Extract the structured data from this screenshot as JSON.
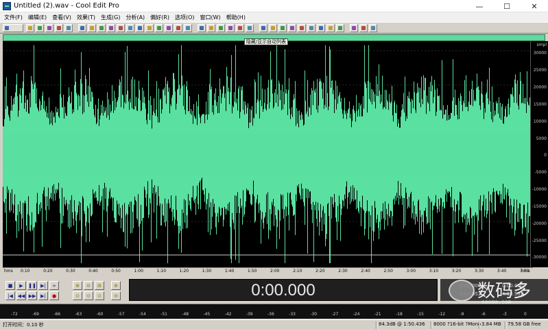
{
  "window": {
    "title": "Untitled (2).wav - Cool Edit Pro",
    "minimize": "—",
    "maximize": "☐",
    "close": "✕"
  },
  "menu": [
    "文件(F)",
    "编辑(E)",
    "查看(V)",
    "效果(T)",
    "生成(G)",
    "分析(A)",
    "偏好(R)",
    "选项(O)",
    "窗口(W)",
    "帮助(H)"
  ],
  "overview": {
    "toggle_label": "隐藏/显示自动列表"
  },
  "amplitude_ruler": {
    "unit": "smpl",
    "labels": [
      "30000",
      "25000",
      "20000",
      "15000",
      "10000",
      "5000",
      "0",
      "-5000",
      "-10000",
      "-15000",
      "-20000",
      "-25000",
      "-30000"
    ]
  },
  "time_ruler": {
    "start": "hms",
    "end": "hms",
    "ticks": [
      "0:10",
      "0:20",
      "0:30",
      "0:40",
      "0:50",
      "1:00",
      "1:10",
      "1:20",
      "1:30",
      "1:40",
      "1:50",
      "2:00",
      "2:10",
      "2:20",
      "2:30",
      "2:40",
      "2:50",
      "3:00",
      "3:10",
      "3:20",
      "3:30",
      "3:40",
      "3:50"
    ]
  },
  "transport": {
    "stop": "■",
    "play": "▶",
    "pause": "❚❚",
    "play_to_end": "▶|",
    "loop": "∞",
    "go_start": "|◀",
    "rewind": "◀◀",
    "forward": "▶▶",
    "go_end": "▶|",
    "record": "●"
  },
  "time_display": "0:00.000",
  "selection": {
    "begin": "0:00.000",
    "end": "4:03.952",
    "begin_value": "0:00.000",
    "end_value": "4:03.952"
  },
  "level_meter": {
    "labels": [
      "-72",
      "-69",
      "-66",
      "-63",
      "-60",
      "-57",
      "-54",
      "-51",
      "-48",
      "-45",
      "-42",
      "-39",
      "-36",
      "-33",
      "-30",
      "-27",
      "-24",
      "-21",
      "-18",
      "-15",
      "-12",
      "-9",
      "-6",
      "-3",
      "0"
    ]
  },
  "status": {
    "open_time": "打开时间：0.10 秒",
    "db": "84.3dB @ 1:50.436",
    "format": "8000 ?16-bit ?Mono",
    "size": "3.84 MB",
    "free": "79.58 GB free"
  },
  "watermark": {
    "text": "数码多",
    "sub": "sooma.com"
  },
  "colors": {
    "waveform": "#5ae0a0",
    "wave_bg": "#000000",
    "overview": "#60d8a0"
  }
}
